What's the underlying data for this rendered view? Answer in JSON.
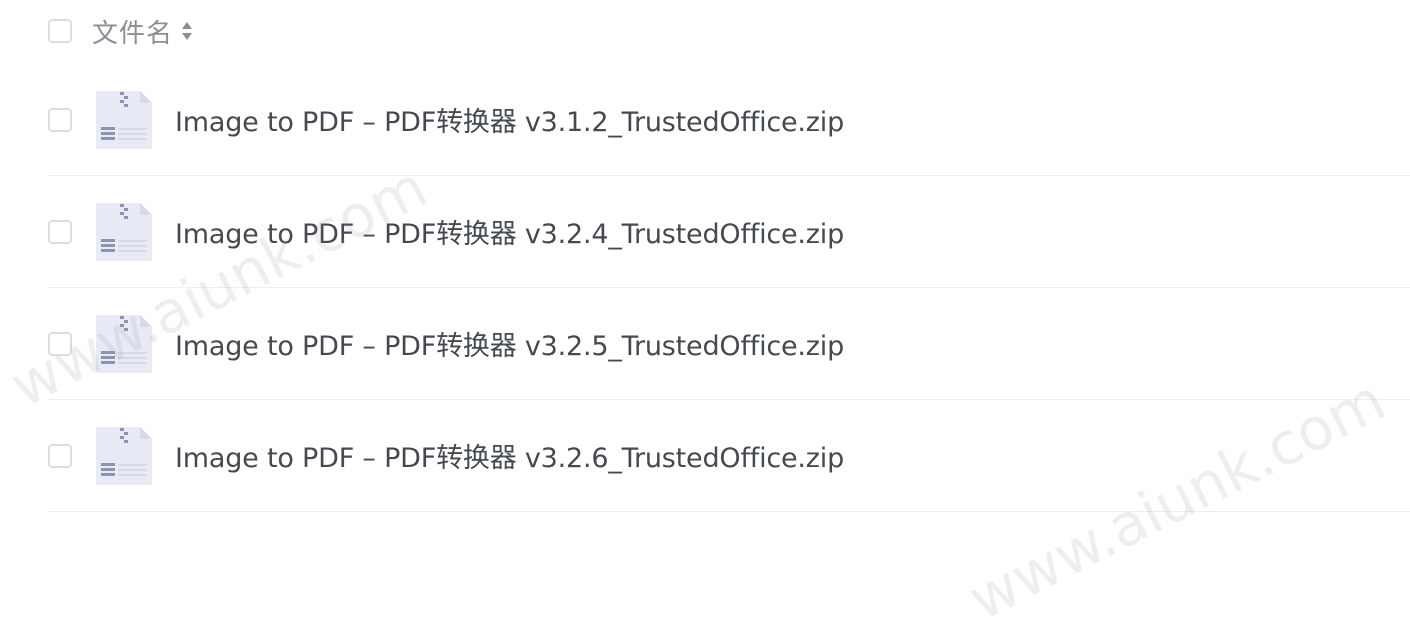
{
  "header": {
    "column_label": "文件名",
    "sort_icon": "sort-updown-icon"
  },
  "files": [
    {
      "name": "Image to PDF – PDF转换器 v3.1.2_TrustedOffice.zip",
      "icon": "zip-file-icon"
    },
    {
      "name": "Image to PDF – PDF转换器 v3.2.4_TrustedOffice.zip",
      "icon": "zip-file-icon"
    },
    {
      "name": "Image to PDF – PDF转换器 v3.2.5_TrustedOffice.zip",
      "icon": "zip-file-icon"
    },
    {
      "name": "Image to PDF – PDF转换器 v3.2.6_TrustedOffice.zip",
      "icon": "zip-file-icon"
    }
  ],
  "watermark": {
    "text": "www.aiunk.com"
  },
  "colors": {
    "text_primary": "#454950",
    "text_header": "#8a8e96",
    "checkbox_border": "#dadde3",
    "divider": "#eceef2",
    "icon_fill": "#e8ebf6",
    "icon_accent": "#8d94b0"
  }
}
